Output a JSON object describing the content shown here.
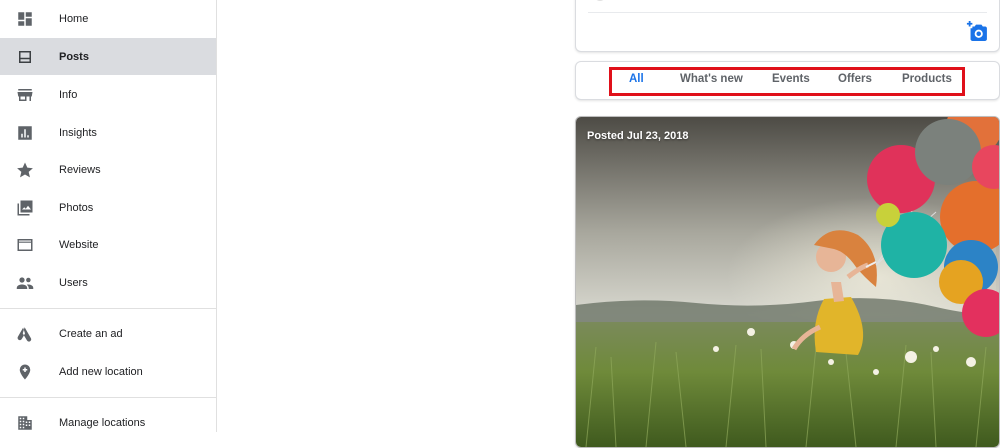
{
  "sidebar": {
    "items": [
      {
        "label": "Home",
        "icon": "dashboard-icon",
        "active": false
      },
      {
        "label": "Posts",
        "icon": "posts-icon",
        "active": true
      },
      {
        "label": "Info",
        "icon": "storefront-icon",
        "active": false
      },
      {
        "label": "Insights",
        "icon": "insights-chart-icon",
        "active": false
      },
      {
        "label": "Reviews",
        "icon": "star-icon",
        "active": false
      },
      {
        "label": "Photos",
        "icon": "photo-library-icon",
        "active": false
      },
      {
        "label": "Website",
        "icon": "website-icon",
        "active": false
      },
      {
        "label": "Users",
        "icon": "people-icon",
        "active": false
      }
    ],
    "secondary_items": [
      {
        "label": "Create an ad",
        "icon": "google-ads-icon"
      },
      {
        "label": "Add new location",
        "icon": "add-location-icon"
      }
    ],
    "tertiary_items": [
      {
        "label": "Manage locations",
        "icon": "manage-locations-icon"
      }
    ]
  },
  "main": {
    "camera_icon": "add-photo-icon",
    "tabs": [
      {
        "label": "All",
        "active": true
      },
      {
        "label": "What's new",
        "active": false
      },
      {
        "label": "Events",
        "active": false
      },
      {
        "label": "Offers",
        "active": false
      },
      {
        "label": "Products",
        "active": false
      }
    ],
    "post": {
      "posted_date": "Posted Jul 23, 2018",
      "image": "girl-with-balloons-photo"
    }
  },
  "colors": {
    "accent": "#1a73e8",
    "highlight_box": "#e0101a",
    "active_nav_bg": "#dadce0"
  }
}
